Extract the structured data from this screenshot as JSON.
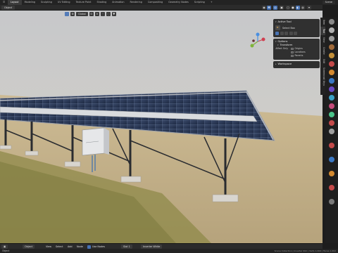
{
  "topbar": {
    "tabs": [
      "Layout",
      "Modeling",
      "Sculpting",
      "UV Editing",
      "Texture Paint",
      "Shading",
      "Animation",
      "Rendering",
      "Compositing",
      "Geometry Nodes",
      "Scripting"
    ],
    "active_tab_index": 0,
    "scene": "Scene"
  },
  "viewport_header": {
    "mode": "Object",
    "orientation": "Global"
  },
  "npanel": {
    "tabs": [
      "Item",
      "Tool",
      "View",
      "Create",
      "Edit",
      "Screencast Keys"
    ],
    "active_tab_index": 1,
    "active_tool": {
      "title": "Active Tool",
      "tool_name": "Select Box"
    },
    "options": {
      "title": "Options",
      "transform_label": "Transform",
      "affect_only_label": "Affect Only",
      "items": [
        "Origins",
        "Locations",
        "Parents"
      ]
    },
    "workspace": {
      "title": "Workspace"
    }
  },
  "bottom_header": {
    "object_mode": "Object",
    "menu_items": [
      "View",
      "Select",
      "Add",
      "Node"
    ],
    "use_nodes_label": "Use Nodes",
    "slot": "Slot 1",
    "image_name": "Inverter White"
  },
  "status": {
    "left": "Object",
    "right": "Scene Collection | Inverter 002 | Verts 1,004 | Faces 1,002"
  },
  "colors": {
    "accent": "#4772b3",
    "panel_bg": "#303030",
    "header_bg": "#2b2b2b",
    "ground": "#c9b48a",
    "solar_cell": "#2a3a5c"
  },
  "icons": [
    "menu-icon",
    "cursor-icon",
    "move-icon",
    "gizmo-icon",
    "overlay-icon",
    "xray-icon",
    "shading-solid-icon",
    "shading-material-icon",
    "shading-render-icon",
    "funnel-icon",
    "magnet-icon",
    "orientation-icon",
    "select-box-icon"
  ]
}
